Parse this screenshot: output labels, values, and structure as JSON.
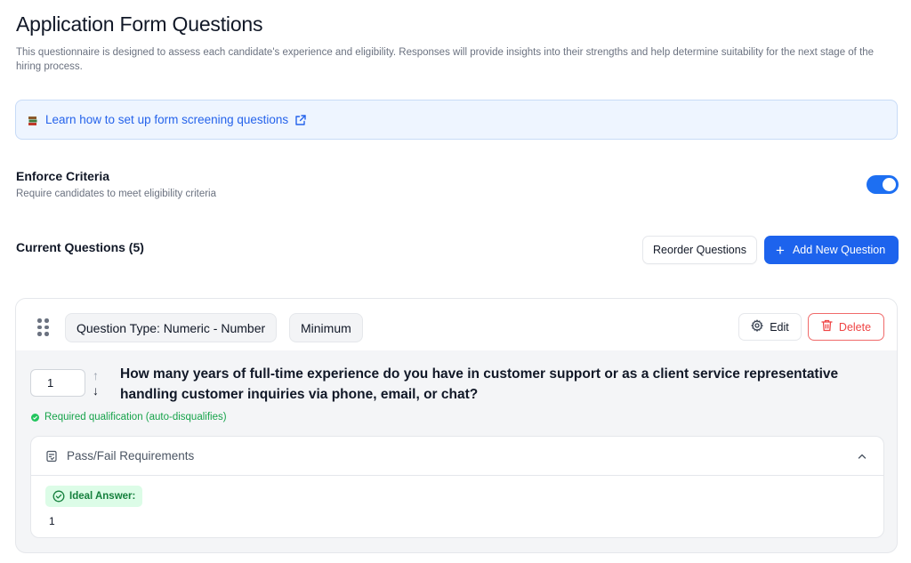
{
  "header": {
    "title": "Application Form Questions",
    "description": "This questionnaire is designed to assess each candidate's experience and eligibility. Responses will provide insights into their strengths and help determine suitability for the next stage of the hiring process."
  },
  "help_banner": {
    "icon": "book-icon",
    "link_text": "Learn how to set up form screening questions",
    "external_icon": "external-link-icon"
  },
  "enforce": {
    "title": "Enforce Criteria",
    "subtitle": "Require candidates to meet eligibility criteria",
    "enabled": true,
    "toggle_color": "#1d6ff2"
  },
  "questions_section": {
    "title": "Current Questions (5)",
    "reorder_label": "Reorder Questions",
    "add_label": "Add New Question",
    "add_color": "#1d63ed"
  },
  "question": {
    "type_chip": "Question Type: Numeric - Number",
    "criteria_chip": "Minimum",
    "edit_label": "Edit",
    "delete_label": "Delete",
    "order_value": "1",
    "text": "How many years of full-time experience do you have in customer support or as a client service representative handling customer inquiries via phone, email, or chat?",
    "required_text": "Required qualification (auto-disqualifies)",
    "pass_fail": {
      "label": "Pass/Fail Requirements",
      "expanded": true,
      "ideal_label": "Ideal Answer:",
      "ideal_value": "1"
    }
  }
}
